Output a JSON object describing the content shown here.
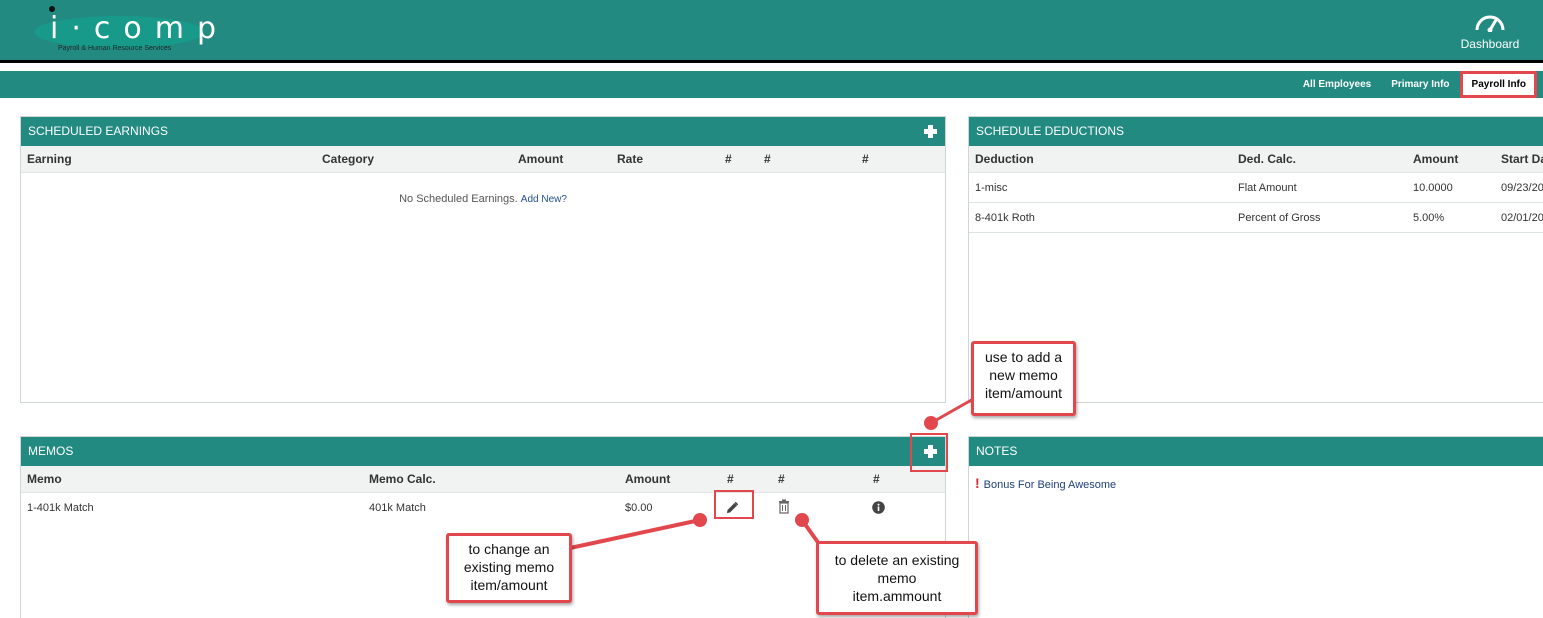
{
  "brand": {
    "logo_text": "i·comp",
    "logo_subtitle": "Payroll & Human Resource Services"
  },
  "header": {
    "dashboard_label": "Dashboard"
  },
  "nav": {
    "items": [
      "All Employees",
      "Primary Info",
      "Payroll Info"
    ],
    "active": "Payroll Info"
  },
  "scheduled_earnings": {
    "title": "SCHEDULED EARNINGS",
    "columns": [
      "Earning",
      "Category",
      "Amount",
      "Rate",
      "#",
      "#",
      "#"
    ],
    "empty_text": "No Scheduled Earnings.",
    "add_new_link": "Add New?"
  },
  "schedule_deductions": {
    "title": "SCHEDULE DEDUCTIONS",
    "columns": [
      "Deduction",
      "Ded. Calc.",
      "Amount",
      "Start Dat"
    ],
    "rows": [
      [
        "1-misc",
        "Flat Amount",
        "10.0000",
        "09/23/20"
      ],
      [
        "8-401k Roth",
        "Percent of Gross",
        "5.00%",
        "02/01/20"
      ]
    ]
  },
  "memos": {
    "title": "MEMOS",
    "columns": [
      "Memo",
      "Memo Calc.",
      "Amount",
      "#",
      "#",
      "#"
    ],
    "rows": [
      [
        "1-401k Match",
        "401k Match",
        "$0.00"
      ]
    ]
  },
  "notes": {
    "title": "NOTES",
    "items": [
      "Bonus For Being Awesome"
    ]
  },
  "callouts": {
    "add": [
      "use to add a",
      "new memo",
      "item/amount"
    ],
    "edit": [
      "to change an",
      "existing memo",
      "item/amount"
    ],
    "delete": [
      "to delete an existing",
      "memo",
      "item.ammount"
    ]
  },
  "colors": {
    "header_teal": "#228a80",
    "callout_red": "#e2474d"
  },
  "icons": {
    "add": "plus-icon",
    "edit": "pencil-icon",
    "delete": "trash-icon",
    "info": "info-circle-icon",
    "dashboard": "speedometer-icon",
    "alert": "exclamation-icon"
  }
}
